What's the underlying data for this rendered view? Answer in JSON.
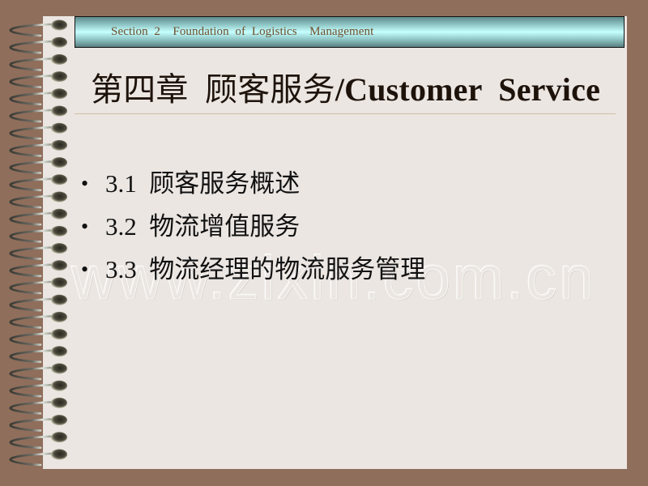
{
  "slide": {
    "header": "Section  2    Foundation  of  Logistics    Management",
    "title_cn": "第四章  顾客服务",
    "title_en": "/Customer  Service",
    "bullets": [
      {
        "marker": "•",
        "text": "3.1  顾客服务概述"
      },
      {
        "marker": "•",
        "text": "3.2  物流增值服务"
      },
      {
        "marker": "•",
        "text": "3.3  物流经理的物流服务管理"
      }
    ],
    "watermark": "www.zixin.com.cn",
    "colors": {
      "background": "#8f6e5b",
      "page": "#ebe6e2",
      "header_text": "#6f4e2b",
      "header_band": "#c6ffff"
    },
    "binding_rings": 26
  }
}
